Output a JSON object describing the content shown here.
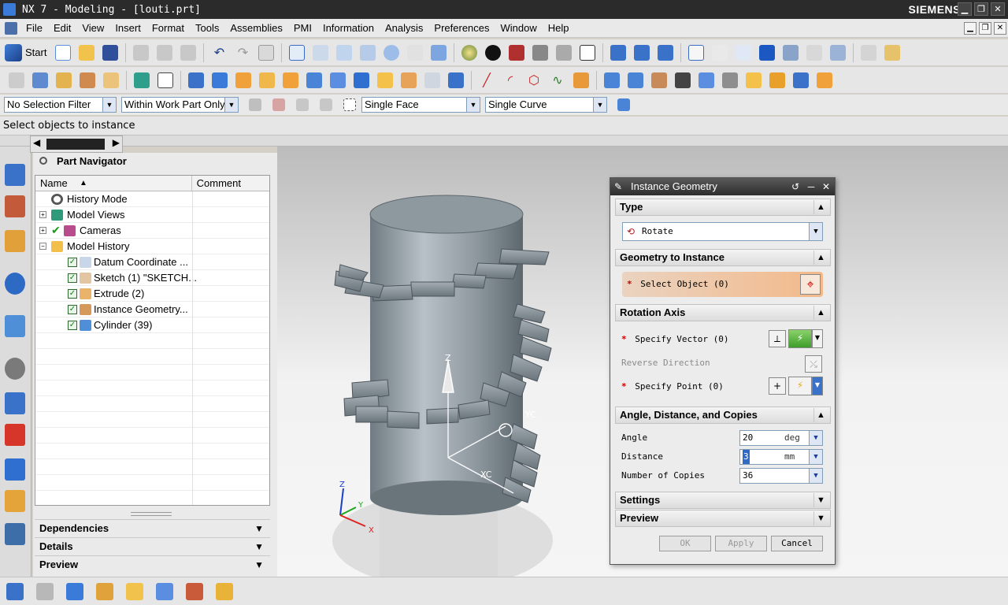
{
  "window": {
    "title": "NX 7 - Modeling - [louti.prt]",
    "brand": "SIEMENS",
    "buttons": {
      "minimize": "▁",
      "restore": "❐",
      "close": "✕"
    }
  },
  "menu": {
    "items": [
      "File",
      "Edit",
      "View",
      "Insert",
      "Format",
      "Tools",
      "Assemblies",
      "PMI",
      "Information",
      "Analysis",
      "Preferences",
      "Window",
      "Help"
    ]
  },
  "toolbar": {
    "start_label": "Start"
  },
  "selection_bar": {
    "filter": "No Selection Filter",
    "scope": "Within Work Part Only",
    "face_rule": "Single Face",
    "curve_rule": "Single Curve"
  },
  "cue_line": "Select objects to instance",
  "part_navigator": {
    "title": "Part Navigator",
    "columns": {
      "name": "Name",
      "sort": "▲",
      "comment": "Comment"
    },
    "rows": [
      {
        "label": "History Mode",
        "icon": "clock-icon"
      },
      {
        "label": "Model Views",
        "icon": "views-icon",
        "expander": "+"
      },
      {
        "label": "Cameras",
        "icon": "camera-icon",
        "expander": "+",
        "checked": true
      },
      {
        "label": "Model History",
        "icon": "folder-icon",
        "expander": "−"
      },
      {
        "label": "Datum Coordinate ...",
        "icon": "datum-csys-icon",
        "checked": true
      },
      {
        "label": "Sketch (1) \"SKETCH...",
        "icon": "sketch-icon",
        "checked": true
      },
      {
        "label": "Extrude (2)",
        "icon": "extrude-icon",
        "checked": true
      },
      {
        "label": "Instance Geometry...",
        "icon": "instance-geometry-icon",
        "checked": true
      },
      {
        "label": "Cylinder (39)",
        "icon": "cylinder-icon",
        "checked": true
      }
    ],
    "sections": [
      "Dependencies",
      "Details",
      "Preview"
    ]
  },
  "dialog": {
    "title": "Instance Geometry",
    "type_section": "Type",
    "type_value": "Rotate",
    "geometry_section": "Geometry to Instance",
    "select_object": "Select Object (0)",
    "axis_section": "Rotation Axis",
    "specify_vector": "Specify Vector (0)",
    "reverse_direction": "Reverse Direction",
    "specify_point": "Specify Point (0)",
    "adc_section": "Angle, Distance, and Copies",
    "angle_label": "Angle",
    "angle_value": "20",
    "angle_unit": "deg",
    "distance_label": "Distance",
    "distance_value": "3",
    "distance_unit": "mm",
    "copies_label": "Number of Copies",
    "copies_value": "36",
    "settings_section": "Settings",
    "preview_section": "Preview",
    "ok": "OK",
    "apply": "Apply",
    "cancel": "Cancel"
  },
  "viewport": {
    "triad_labels": {
      "z": "Z",
      "y": "Y",
      "x": "X",
      "zc": "Z",
      "yc": "YC",
      "xc": "XC"
    }
  },
  "colors": {
    "title_bar": "#2b2b2b",
    "dialog_accent": "#f3b98a",
    "model_gray": "#8f9aa2"
  }
}
